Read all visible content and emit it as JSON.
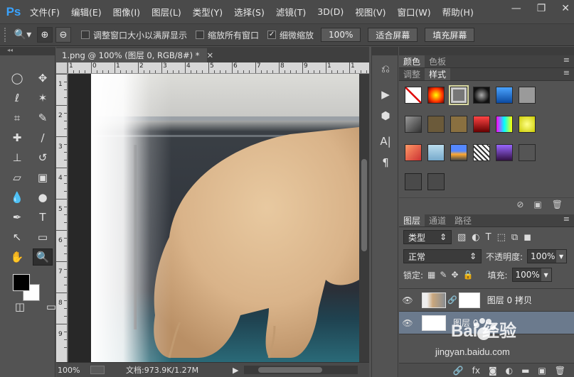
{
  "app": {
    "logo": "Ps"
  },
  "menu": [
    "文件(F)",
    "编辑(E)",
    "图像(I)",
    "图层(L)",
    "类型(Y)",
    "选择(S)",
    "滤镜(T)",
    "3D(D)",
    "视图(V)",
    "窗口(W)",
    "帮助(H)"
  ],
  "window_controls": {
    "minimize": "—",
    "restore": "❐",
    "close": "✕"
  },
  "options": {
    "resize_windows": "调整窗口大小以满屏显示",
    "zoom_all": "缩放所有窗口",
    "scrubby": "细微缩放",
    "scrubby_checked": true,
    "zoom_100": "100%",
    "fit_screen": "适合屏幕",
    "fill_screen": "填充屏幕"
  },
  "document": {
    "tab_title": "1.png @ 100% (图层 0, RGB/8#) *",
    "ruler_top": [
      "1",
      "0",
      "1",
      "2",
      "3",
      "4",
      "5",
      "6",
      "7",
      "8",
      "9",
      "1",
      "1"
    ],
    "ruler_left": [
      "1",
      "2",
      "3",
      "4",
      "5",
      "6",
      "7",
      "8",
      "9"
    ],
    "zoom": "100%",
    "doc_info": "文档:973.9K/1.27M"
  },
  "panels": {
    "color_tabs": [
      "颜色",
      "色板"
    ],
    "style_tabs": [
      "调整",
      "样式"
    ],
    "layers_tabs": [
      "图层",
      "通道",
      "路径"
    ],
    "filter_kind": "类型",
    "blend_mode": "正常",
    "opacity_label": "不透明度:",
    "opacity_value": "100%",
    "lock_label": "锁定:",
    "fill_label": "填充:",
    "fill_value": "100%",
    "layers": [
      {
        "name": "图层 0 拷贝",
        "selected": false
      },
      {
        "name": "图层 0",
        "selected": true
      }
    ]
  },
  "watermark": {
    "text": "Bai 经验",
    "url": "jingyan.baidu.com"
  }
}
